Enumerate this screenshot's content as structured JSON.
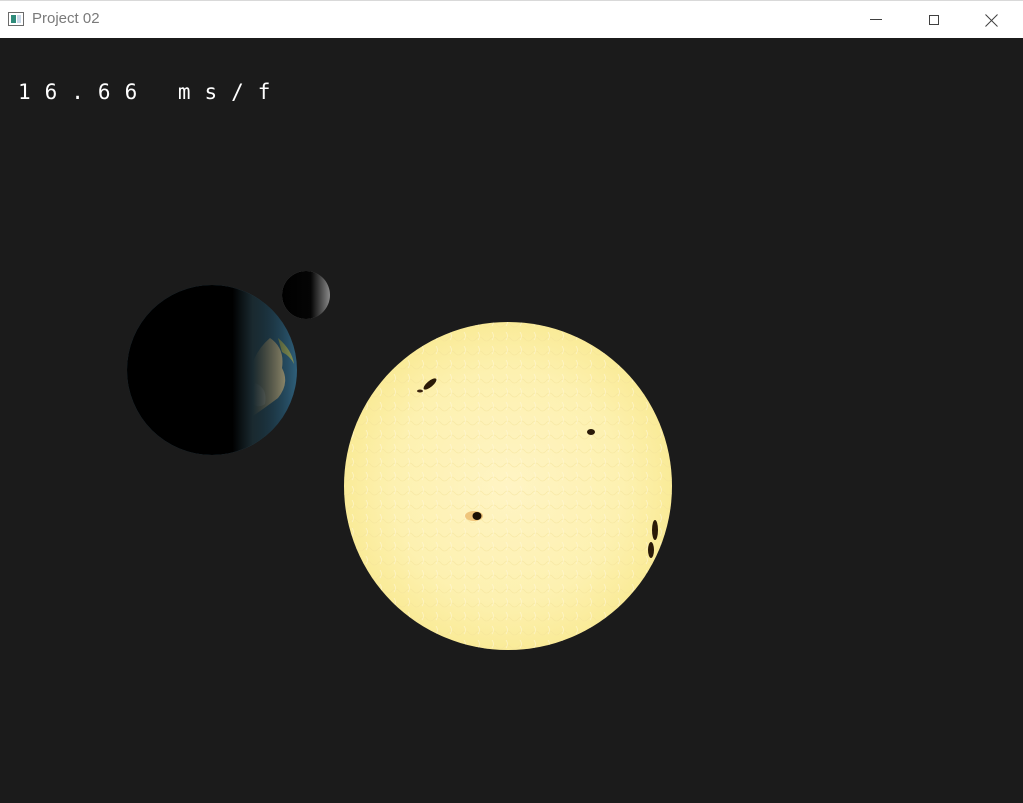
{
  "window": {
    "title": "Project 02",
    "icon": "app-window-icon",
    "controls": {
      "minimize_icon": "minimize-icon",
      "maximize_icon": "maximize-icon",
      "close_icon": "close-icon"
    }
  },
  "viewport": {
    "background": "#1b1b1b",
    "frame_time": "16.66 ms/f"
  },
  "scene": {
    "bodies": [
      "earth",
      "moon",
      "sun"
    ],
    "colors": {
      "sun": "#fdf3b4",
      "sunspot": "#2a1a08",
      "earth_ocean": "#2f5f7a",
      "earth_land": "#b8b08a",
      "moon": "#8a8a8a"
    }
  }
}
